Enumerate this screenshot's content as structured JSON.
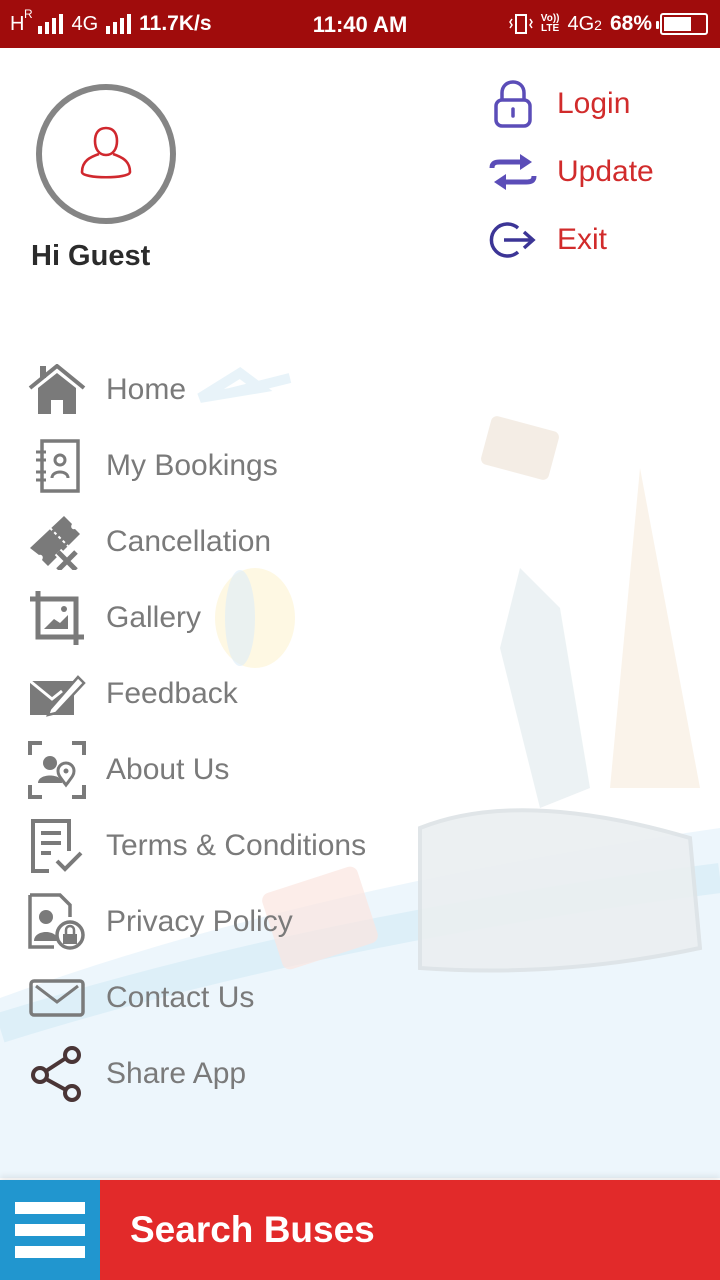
{
  "status_bar": {
    "network_1": "H",
    "roaming": "R",
    "network_2": "4G",
    "speed": "11.7K/s",
    "time": "11:40 AM",
    "volte_top": "Vo))",
    "volte_bottom": "LTE",
    "network_3": "4G",
    "sim": "2",
    "battery_percent": "68%",
    "battery_level": 0.68
  },
  "profile": {
    "greeting": "Hi Guest",
    "avatar_icon": "user-icon"
  },
  "actions": [
    {
      "label": "Login",
      "icon": "lock-icon"
    },
    {
      "label": "Update",
      "icon": "swap-arrows-icon"
    },
    {
      "label": "Exit",
      "icon": "logout-icon"
    }
  ],
  "menu": [
    {
      "label": "Home",
      "icon": "home-icon"
    },
    {
      "label": "My Bookings",
      "icon": "contact-book-icon"
    },
    {
      "label": "Cancellation",
      "icon": "ticket-cancel-icon"
    },
    {
      "label": "Gallery",
      "icon": "image-crop-icon"
    },
    {
      "label": "Feedback",
      "icon": "mail-pencil-icon"
    },
    {
      "label": "About Us",
      "icon": "person-location-icon"
    },
    {
      "label": "Terms & Conditions",
      "icon": "document-check-icon"
    },
    {
      "label": "Privacy Policy",
      "icon": "user-file-lock-icon"
    },
    {
      "label": "Contact Us",
      "icon": "envelope-icon"
    },
    {
      "label": "Share App",
      "icon": "share-icon"
    }
  ],
  "bottom_bar": {
    "menu_icon": "hamburger-icon",
    "search_label": "Search Buses"
  },
  "colors": {
    "status_bar": "#a00c0c",
    "accent_red": "#e22a2a",
    "action_text": "#d12b2b",
    "action_icon": "#5b4db8",
    "hamburger_bg": "#2196cf",
    "menu_text": "#7a7a7a"
  }
}
